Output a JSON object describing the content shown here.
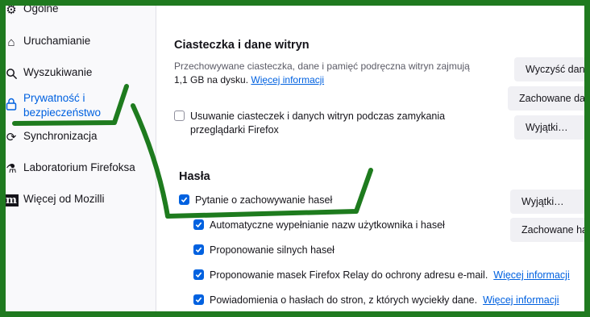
{
  "sidebar": {
    "items": [
      {
        "label": "Ogólne",
        "icon": "gear-icon"
      },
      {
        "label": "Uruchamianie",
        "icon": "home-icon"
      },
      {
        "label": "Wyszukiwanie",
        "icon": "search-icon"
      },
      {
        "label": "Prywatność i bezpieczeństwo",
        "icon": "lock-icon",
        "active": true
      },
      {
        "label": "Synchronizacja",
        "icon": "sync-icon"
      },
      {
        "label": "Laboratorium Firefoksa",
        "icon": "flask-icon"
      },
      {
        "label": "Więcej od Mozilli",
        "icon": "mozilla-icon"
      }
    ]
  },
  "cookies": {
    "title": "Ciasteczka i dane witryn",
    "desc_prefix": "Przechowywane ciasteczka, dane i pamięć podręczna witryn zajmują",
    "size": "1,1 GB na dysku.",
    "more_info": "Więcej informacji",
    "clear_button": "Wyczyść dane…",
    "saved_button": "Zachowane dane…",
    "exceptions_button": "Wyjątki…",
    "delete_on_close": {
      "label": "Usuwanie ciasteczek i danych witryn podczas zamykania przeglądarki Firefox",
      "checked": false
    }
  },
  "passwords": {
    "title": "Hasła",
    "ask_save": {
      "label": "Pytanie o zachowywanie haseł",
      "checked": true
    },
    "exceptions_button": "Wyjątki…",
    "saved_button": "Zachowane hasła…",
    "autofill": {
      "label": "Automatyczne wypełnianie nazw użytkownika i haseł",
      "checked": true
    },
    "suggest_strong": {
      "label": "Proponowanie silnych haseł",
      "checked": true
    },
    "relay": {
      "label": "Proponowanie masek Firefox Relay do ochrony adresu e-mail.",
      "link": "Więcej informacji",
      "checked": true
    },
    "breach_alerts": {
      "label": "Powiadomienia o hasłach do stron, z których wyciekły dane.",
      "link": "Więcej informacji",
      "checked": true
    }
  },
  "colors": {
    "accent": "#0061e0",
    "frame": "#1f7a1f",
    "annotation": "#1e7b1e"
  }
}
